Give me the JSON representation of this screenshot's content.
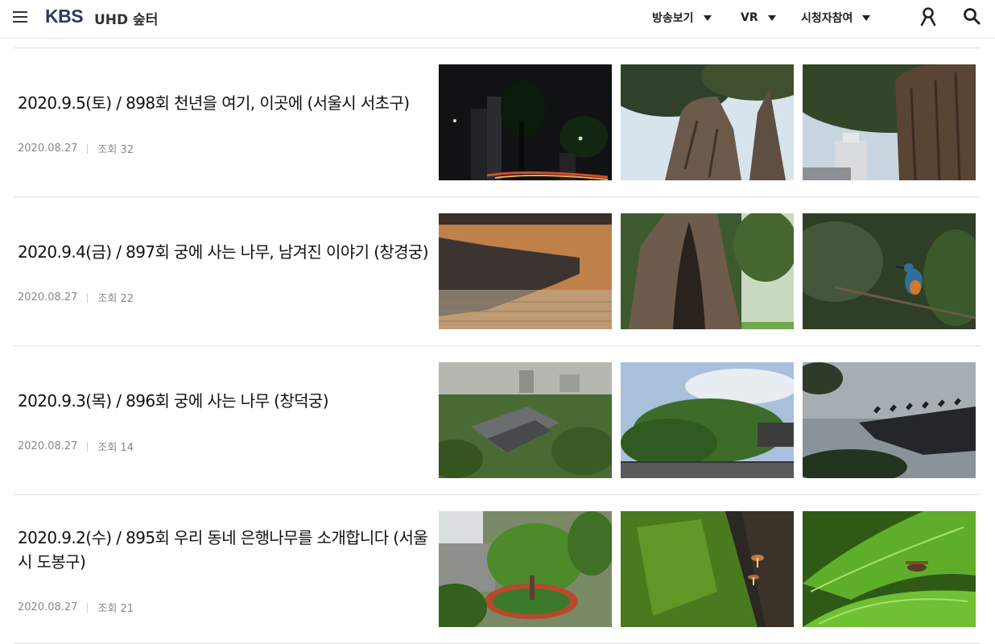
{
  "header": {
    "logo": "KBS",
    "title": "UHD 숲터",
    "nav": [
      "방송보기",
      "VR",
      "시청자참여"
    ],
    "icons": [
      "menu-icon",
      "user-icon",
      "search-icon"
    ]
  },
  "items": [
    {
      "title": "2020.9.5(토) / 898회 천년을 여기, 이곳에 (서울시 서초구)",
      "date": "2020.08.27",
      "views": "조회 32"
    },
    {
      "title": "2020.9.4(금) / 897회 궁에 사는 나무, 남겨진 이야기 (창경궁)",
      "date": "2020.08.27",
      "views": "조회 22"
    },
    {
      "title": "2020.9.3(목) / 896회 궁에 사는 나무 (창덕궁)",
      "date": "2020.08.27",
      "views": "조회 14"
    },
    {
      "title": "2020.9.2(수) / 895회 우리 동네 은행나무를 소개합니다 (서울시 도봉구)",
      "date": "2020.08.27",
      "views": "조회 21"
    }
  ],
  "colors": {
    "logo": "#2a3a63",
    "divider": "#dddddd",
    "meta": "#888888"
  }
}
